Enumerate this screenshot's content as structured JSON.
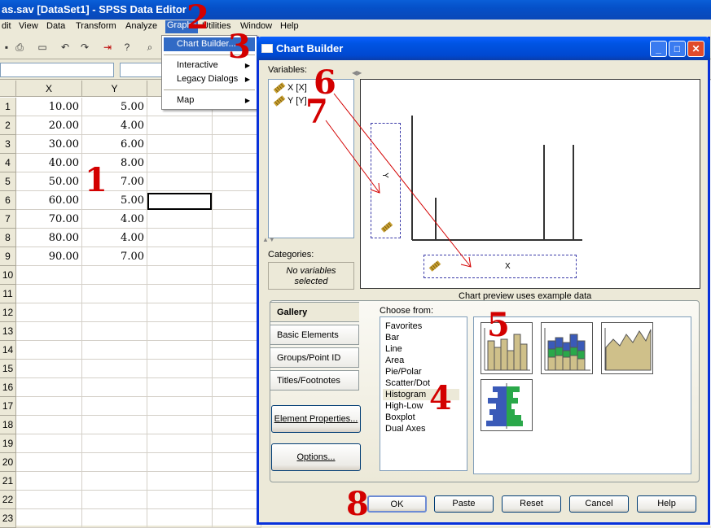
{
  "window": {
    "title": "as.sav [DataSet1] - SPSS Data Editor"
  },
  "menubar": [
    "dit",
    "View",
    "Data",
    "Transform",
    "Analyze",
    "Graphs",
    "Utilities",
    "Window",
    "Help"
  ],
  "graphs_menu": {
    "items": [
      {
        "label": "Chart Builder...",
        "selected": true,
        "submenu": false
      },
      {
        "label": "Interactive",
        "submenu": true
      },
      {
        "label": "Legacy Dialogs",
        "submenu": true
      },
      {
        "label": "Map",
        "submenu": true
      }
    ]
  },
  "grid": {
    "columns": [
      "X",
      "Y"
    ],
    "rows": [
      {
        "n": "1",
        "x": "10.00",
        "y": "5.00"
      },
      {
        "n": "2",
        "x": "20.00",
        "y": "4.00"
      },
      {
        "n": "3",
        "x": "30.00",
        "y": "6.00"
      },
      {
        "n": "4",
        "x": "40.00",
        "y": "8.00"
      },
      {
        "n": "5",
        "x": "50.00",
        "y": "7.00"
      },
      {
        "n": "6",
        "x": "60.00",
        "y": "5.00"
      },
      {
        "n": "7",
        "x": "70.00",
        "y": "4.00"
      },
      {
        "n": "8",
        "x": "80.00",
        "y": "4.00"
      },
      {
        "n": "9",
        "x": "90.00",
        "y": "7.00"
      },
      {
        "n": "10",
        "x": "",
        "y": ""
      },
      {
        "n": "11",
        "x": "",
        "y": ""
      },
      {
        "n": "12",
        "x": "",
        "y": ""
      },
      {
        "n": "13",
        "x": "",
        "y": ""
      },
      {
        "n": "14",
        "x": "",
        "y": ""
      },
      {
        "n": "15",
        "x": "",
        "y": ""
      },
      {
        "n": "16",
        "x": "",
        "y": ""
      },
      {
        "n": "17",
        "x": "",
        "y": ""
      },
      {
        "n": "18",
        "x": "",
        "y": ""
      },
      {
        "n": "19",
        "x": "",
        "y": ""
      },
      {
        "n": "20",
        "x": "",
        "y": ""
      },
      {
        "n": "21",
        "x": "",
        "y": ""
      },
      {
        "n": "22",
        "x": "",
        "y": ""
      },
      {
        "n": "23",
        "x": "",
        "y": ""
      }
    ]
  },
  "dialog": {
    "title": "Chart Builder",
    "variables_label": "Variables:",
    "variables": [
      "X [X]",
      "Y [Y]"
    ],
    "categories_label": "Categories:",
    "no_variables": "No variables selected",
    "y_axis_drop": "Y",
    "x_axis_drop": "X",
    "preview_note": "Chart preview uses example data",
    "tabs": [
      "Gallery",
      "Basic Elements",
      "Groups/Point ID",
      "Titles/Footnotes"
    ],
    "choose_from_label": "Choose from:",
    "chart_types": [
      "Favorites",
      "Bar",
      "Line",
      "Area",
      "Pie/Polar",
      "Scatter/Dot",
      "Histogram",
      "High-Low",
      "Boxplot",
      "Dual Axes"
    ],
    "selected_chart_type": "Histogram",
    "element_properties_button": "Element Properties...",
    "options_button": "Options...",
    "buttons": {
      "ok": "OK",
      "paste": "Paste",
      "reset": "Reset",
      "cancel": "Cancel",
      "help": "Help"
    }
  },
  "annotations": [
    "1",
    "2",
    "3",
    "4",
    "5",
    "6",
    "7",
    "8"
  ],
  "colors": {
    "annotation": "#d30000",
    "titlebar": "#0054e3",
    "selection": "#316ac5"
  }
}
